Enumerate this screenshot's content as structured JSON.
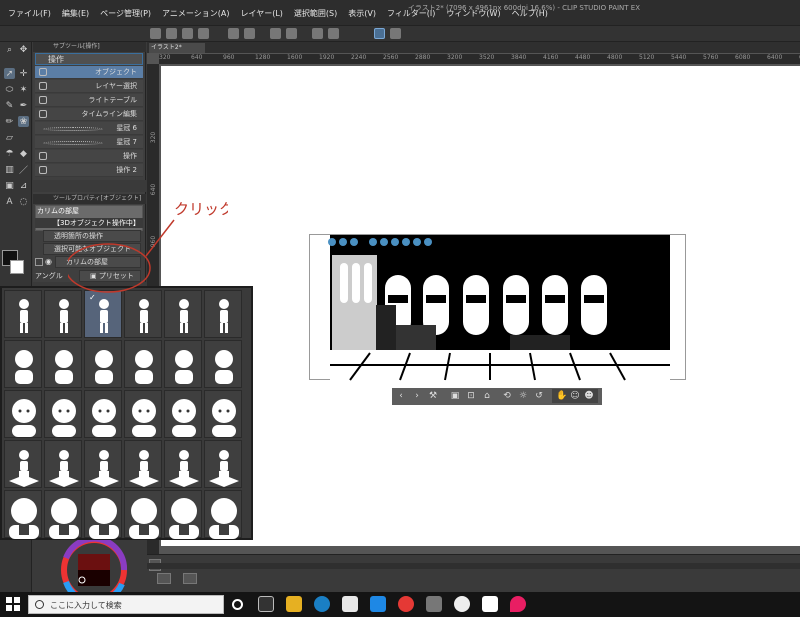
{
  "app": {
    "title": "イラスト2* (7096 x 4961px 600dpi 16.6%) - CLIP STUDIO PAINT EX",
    "menu": [
      "ファイル(F)",
      "編集(E)",
      "ページ管理(P)",
      "アニメーション(A)",
      "レイヤー(L)",
      "選択範囲(S)",
      "表示(V)",
      "フィルター(I)",
      "ウィンドウ(W)",
      "ヘルプ(H)"
    ]
  },
  "document": {
    "tab_label": "イラスト2*",
    "ruler_marks": [
      "320",
      "640",
      "960",
      "1280",
      "1600",
      "1920",
      "2240",
      "2560",
      "2880",
      "3200",
      "3520",
      "3840",
      "4160",
      "4480",
      "4800",
      "5120",
      "5440",
      "5760",
      "6080",
      "6400",
      "6720",
      "7040"
    ],
    "vruler_marks": [
      "320",
      "640",
      "960",
      "1280"
    ],
    "zoom_text": "16.6"
  },
  "subtool": {
    "header": "サブツール[操作]",
    "tab": "操作",
    "items": [
      {
        "label": "オブジェクト",
        "active": true
      },
      {
        "label": "レイヤー選択",
        "active": false
      },
      {
        "label": "ライトテーブル",
        "active": false
      },
      {
        "label": "タイムライン編集",
        "active": false
      },
      {
        "label": "星冠 6",
        "active": false
      },
      {
        "label": "星冠 7",
        "active": false
      },
      {
        "label": "操作",
        "active": false
      },
      {
        "label": "操作 2",
        "active": false
      }
    ]
  },
  "tool_property": {
    "header": "ツールプロパティ[オブジェクト]",
    "name": "カリムの部屋",
    "layer_label": "【3Dオブジェクト操作中】",
    "buttons": [
      "透明箇所の操作",
      "選択可能なオブジェクト"
    ],
    "object_name": "カリムの部屋",
    "angle_label": "アングル",
    "preset_label": "プリセット"
  },
  "annotation": {
    "text": "クリック"
  },
  "taskbar": {
    "search_placeholder": "ここに入力して検索"
  },
  "colors": {
    "accent": "#5b7ea6",
    "selected_cell": "#56647a",
    "annotation": "#c0392b"
  }
}
